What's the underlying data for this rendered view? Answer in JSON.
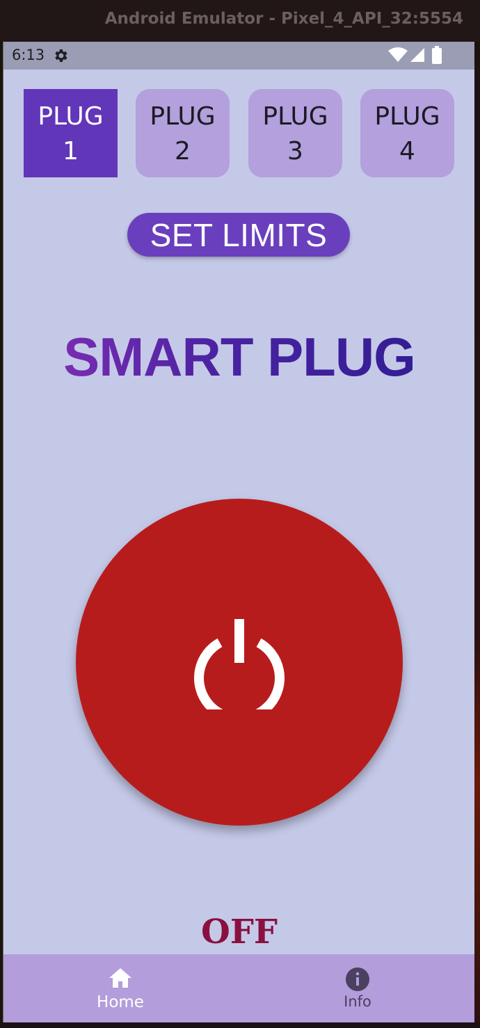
{
  "window": {
    "title": "Android Emulator - Pixel_4_API_32:5554"
  },
  "status_bar": {
    "time": "6:13"
  },
  "plugs": [
    {
      "line1": "PLUG",
      "line2": "1",
      "selected": true
    },
    {
      "line1": "PLUG",
      "line2": "2",
      "selected": false
    },
    {
      "line1": "PLUG",
      "line2": "3",
      "selected": false
    },
    {
      "line1": "PLUG",
      "line2": "4",
      "selected": false
    }
  ],
  "set_limits_label": "SET LIMITS",
  "app_title": "SMART PLUG",
  "power": {
    "state_label": "OFF"
  },
  "nav": {
    "home_label": "Home",
    "info_label": "Info"
  },
  "colors": {
    "background": "#c5c9e8",
    "selected_plug": "#6236b8",
    "unselected_plug": "#b3a0dd",
    "power_off": "#b71c1c",
    "nav_bar": "#b39ddb",
    "state_label": "#8a1040"
  },
  "icons": {
    "status": [
      "gear-icon",
      "wifi-icon",
      "cell-signal-icon",
      "battery-icon"
    ],
    "power": "power-icon",
    "nav": [
      "home-icon",
      "info-icon"
    ]
  }
}
